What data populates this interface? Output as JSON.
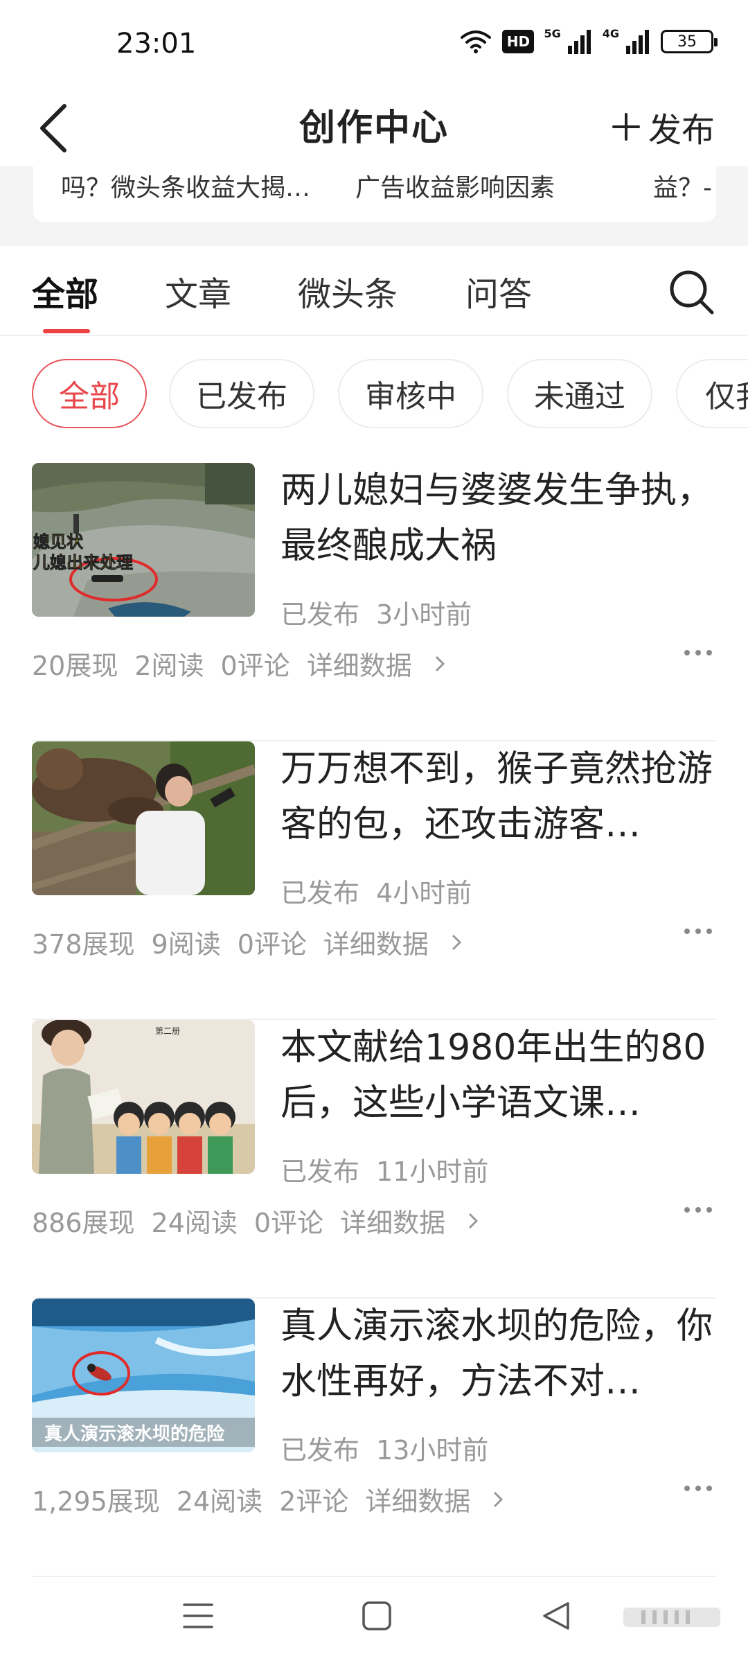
{
  "status_bar": {
    "time": "23:01",
    "network_5g": "5G",
    "network_4g": "4G",
    "hd_badge": "HD",
    "battery": "35"
  },
  "header": {
    "title": "创作中心",
    "publish_label": "发布"
  },
  "banner": {
    "items": [
      "吗？微头条收益大揭…",
      "广告收益影响因素",
      "益？-"
    ]
  },
  "tabs": {
    "items": [
      "全部",
      "文章",
      "微头条",
      "问答"
    ],
    "active_index": 0
  },
  "filters": {
    "items": [
      "全部",
      "已发布",
      "审核中",
      "未通过",
      "仅我"
    ],
    "active_index": 0
  },
  "articles": [
    {
      "title": "两儿媳妇与婆婆发生争执，最终酿成大祸",
      "status": "已发布",
      "time": "3小时前",
      "impressions": "20展现",
      "reads": "2阅读",
      "comments": "0评论",
      "detail_label": "详细数据",
      "thumb_caption_1": "媳见状",
      "thumb_caption_2": "儿媳出来处理"
    },
    {
      "title": "万万想不到，猴子竟然抢游客的包，还攻击游客…",
      "status": "已发布",
      "time": "4小时前",
      "impressions": "378展现",
      "reads": "9阅读",
      "comments": "0评论",
      "detail_label": "详细数据"
    },
    {
      "title": "本文献给1980年出生的80后，这些小学语文课…",
      "status": "已发布",
      "time": "11小时前",
      "impressions": "886展现",
      "reads": "24阅读",
      "comments": "0评论",
      "detail_label": "详细数据",
      "thumb_caption_1": "第二册"
    },
    {
      "title": "真人演示滚水坝的危险，你水性再好，方法不对…",
      "status": "已发布",
      "time": "13小时前",
      "impressions": "1,295展现",
      "reads": "24阅读",
      "comments": "2评论",
      "detail_label": "详细数据",
      "thumb_caption_1": "真人演示滚水坝的危险"
    }
  ],
  "colors": {
    "accent": "#f04142",
    "chip_active": "#e8454b",
    "text_primary": "#222222",
    "text_secondary": "#999999"
  },
  "icons": [
    "back-icon",
    "plus-icon",
    "search-icon",
    "chevron-right-icon",
    "more-icon",
    "wifi-icon",
    "signal-icon",
    "battery-icon",
    "menu-icon",
    "home-icon",
    "back-triangle-icon"
  ]
}
